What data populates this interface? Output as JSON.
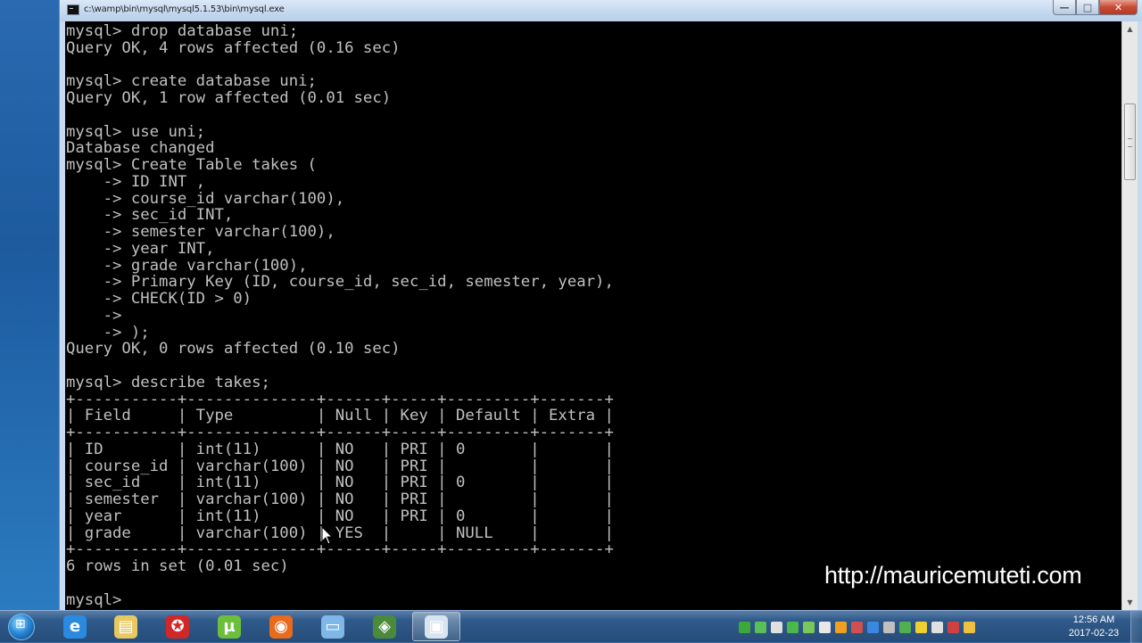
{
  "window": {
    "title": "c:\\wamp\\bin\\mysql\\mysql5.1.53\\bin\\mysql.exe",
    "minimize_label": "—",
    "maximize_label": "□",
    "close_label": "✕"
  },
  "console": {
    "text": "mysql> drop database uni;\nQuery OK, 4 rows affected (0.16 sec)\n\nmysql> create database uni;\nQuery OK, 1 row affected (0.01 sec)\n\nmysql> use uni;\nDatabase changed\nmysql> Create Table takes (\n    -> ID INT ,\n    -> course_id varchar(100),\n    -> sec_id INT,\n    -> semester varchar(100),\n    -> year INT,\n    -> grade varchar(100),\n    -> Primary Key (ID, course_id, sec_id, semester, year),\n    -> CHECK(ID > 0)\n    ->\n    -> );\nQuery OK, 0 rows affected (0.10 sec)\n\nmysql> describe takes;\n+-----------+--------------+------+-----+---------+-------+\n| Field     | Type         | Null | Key | Default | Extra |\n+-----------+--------------+------+-----+---------+-------+\n| ID        | int(11)      | NO   | PRI | 0       |       |\n| course_id | varchar(100) | NO   | PRI |         |       |\n| sec_id    | int(11)      | NO   | PRI | 0       |       |\n| semester  | varchar(100) | NO   | PRI |         |       |\n| year      | int(11)      | NO   | PRI | 0       |       |\n| grade     | varchar(100) | YES  |     | NULL    |       |\n+-----------+--------------+------+-----+---------+-------+\n6 rows in set (0.01 sec)\n\nmysql> "
  },
  "watermark": "http://mauricemuteti.com",
  "taskbar": {
    "start_icon": "windows-orb-icon",
    "apps": [
      {
        "name": "internet-explorer-icon",
        "color": "#2a8ae0",
        "glyph": "e"
      },
      {
        "name": "file-explorer-icon",
        "color": "#e8c860",
        "glyph": "▤"
      },
      {
        "name": "app-red-icon",
        "color": "#d02828",
        "glyph": "✪"
      },
      {
        "name": "utorrent-icon",
        "color": "#6cbf3a",
        "glyph": "µ"
      },
      {
        "name": "firefox-icon",
        "color": "#e86a1a",
        "glyph": "◉"
      },
      {
        "name": "notepad-icon",
        "color": "#7fb8e8",
        "glyph": "▭"
      },
      {
        "name": "mysql-tool-icon",
        "color": "#4a8a3a",
        "glyph": "◈"
      },
      {
        "name": "console-window-icon",
        "color": "#d8e4f0",
        "glyph": "▣"
      }
    ],
    "tray_icons": [
      {
        "name": "tray-icon-1",
        "color": "#3aa83a"
      },
      {
        "name": "tray-icon-2",
        "color": "#58c058"
      },
      {
        "name": "tray-icon-3",
        "color": "#e0e0e0"
      },
      {
        "name": "tray-icon-4",
        "color": "#4ab84a"
      },
      {
        "name": "tray-icon-5",
        "color": "#7ac85a"
      },
      {
        "name": "volume-icon",
        "color": "#e8e8e8"
      },
      {
        "name": "tray-icon-7",
        "color": "#f0a020"
      },
      {
        "name": "tray-icon-8",
        "color": "#d05050"
      },
      {
        "name": "tray-icon-9",
        "color": "#3a88e0"
      },
      {
        "name": "tray-icon-10",
        "color": "#c0c0c0"
      },
      {
        "name": "tray-icon-11",
        "color": "#50b050"
      },
      {
        "name": "tray-icon-12",
        "color": "#f0d030"
      },
      {
        "name": "tray-icon-13",
        "color": "#e0e0e0"
      },
      {
        "name": "network-icon",
        "color": "#d04040"
      },
      {
        "name": "action-center-icon",
        "color": "#f0c040"
      }
    ],
    "clock_time": "12:56 AM",
    "clock_date": "2017-02-23"
  }
}
